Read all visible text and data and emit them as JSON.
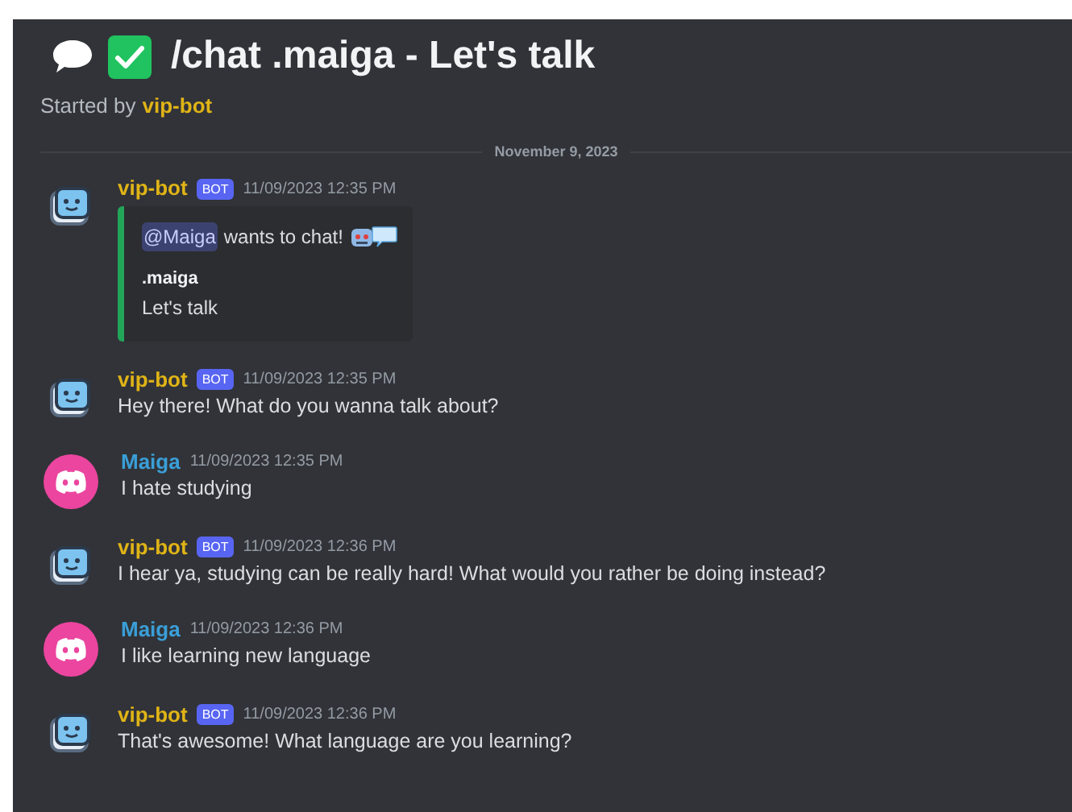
{
  "thread": {
    "title": "/chat .maiga - Let's talk",
    "started_by_label": "Started by",
    "started_by": "vip-bot"
  },
  "date_divider": "November 9, 2023",
  "messages": [
    {
      "kind": "bot",
      "author": "vip-bot",
      "badge": "BOT",
      "time": "11/09/2023 12:35 PM",
      "embed": {
        "mention": "@Maiga",
        "text": "wants to chat!",
        "field_name": ".maiga",
        "field_value": "Let's talk"
      }
    },
    {
      "kind": "bot",
      "author": "vip-bot",
      "badge": "BOT",
      "time": "11/09/2023 12:35 PM",
      "text": "Hey there! What do you wanna talk about?"
    },
    {
      "kind": "user",
      "author": "Maiga",
      "time": "11/09/2023 12:35 PM",
      "text": "I hate studying"
    },
    {
      "kind": "bot",
      "author": "vip-bot",
      "badge": "BOT",
      "time": "11/09/2023 12:36 PM",
      "text": "I hear ya, studying can be really hard! What would you rather be doing instead?"
    },
    {
      "kind": "user",
      "author": "Maiga",
      "time": "11/09/2023 12:36 PM",
      "text": "I like learning new language"
    },
    {
      "kind": "bot",
      "author": "vip-bot",
      "badge": "BOT",
      "time": "11/09/2023 12:36 PM",
      "text": "That's awesome! What language are you learning?"
    }
  ]
}
